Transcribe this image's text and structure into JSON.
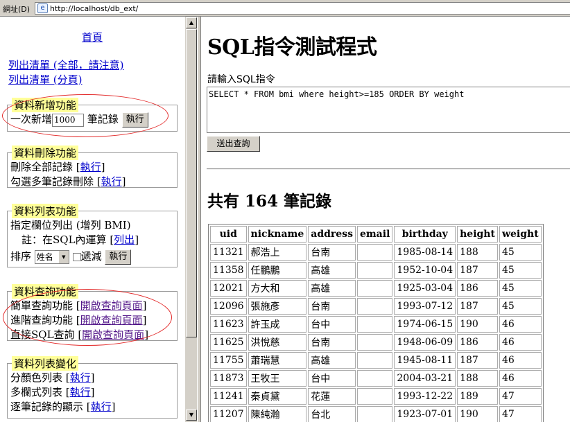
{
  "address_bar": {
    "label": "網址(D)",
    "url": "http://localhost/db_ext/"
  },
  "left": {
    "home_link": "首頁",
    "list_all": "列出清單 (全部，請注意)",
    "list_paged": "列出清單 (分頁)",
    "add": {
      "legend": "資料新增功能",
      "prefix": "一次新增",
      "value": "1000",
      "suffix": "筆記錄",
      "button": "執行"
    },
    "delete": {
      "legend": "資料刪除功能",
      "line1": "刪除全部記錄",
      "line2": "勾選多筆記錄刪除",
      "link": "執行"
    },
    "listfn": {
      "legend": "資料列表功能",
      "line1": "指定欄位列出 (增列 BMI)",
      "note_prefix": "註：在SQL內運算",
      "note_link": "列出",
      "sort_label": "排序",
      "sort_value": "姓名",
      "desc_label": "遞減",
      "button": "執行"
    },
    "query": {
      "legend": "資料查詢功能",
      "line1": "簡單查詢功能",
      "line2": "進階查詢功能",
      "line3": "直接SQL查詢",
      "link": "開啟查詢頁面"
    },
    "vary": {
      "legend": "資料列表變化",
      "line1": "分顏色列表",
      "line2": "多欄式列表",
      "line3": "逐筆記錄的顯示",
      "link": "執行"
    }
  },
  "right": {
    "title": "SQL指令測試程式",
    "prompt": "請輸入SQL指令",
    "sql": "SELECT * FROM bmi where height>=185 ORDER BY weight",
    "submit": "送出查詢",
    "count": "共有 164 筆記錄",
    "columns": [
      "uid",
      "nickname",
      "address",
      "email",
      "birthday",
      "height",
      "weight"
    ],
    "rows": [
      [
        "11321",
        "郝浩上",
        "台南",
        "",
        "1985-08-14",
        "188",
        "45"
      ],
      [
        "11358",
        "任鵬鵬",
        "高雄",
        "",
        "1952-10-04",
        "187",
        "45"
      ],
      [
        "12021",
        "方大和",
        "高雄",
        "",
        "1925-03-04",
        "186",
        "45"
      ],
      [
        "12096",
        "張施彥",
        "台南",
        "",
        "1993-07-12",
        "187",
        "45"
      ],
      [
        "11623",
        "許玉成",
        "台中",
        "",
        "1974-06-15",
        "190",
        "46"
      ],
      [
        "11625",
        "洪悅慈",
        "台南",
        "",
        "1948-06-09",
        "186",
        "46"
      ],
      [
        "11755",
        "蕭瑞慧",
        "高雄",
        "",
        "1945-08-11",
        "187",
        "46"
      ],
      [
        "11873",
        "王牧王",
        "台中",
        "",
        "2004-03-21",
        "188",
        "46"
      ],
      [
        "11241",
        "秦貞黛",
        "花蓮",
        "",
        "1993-12-22",
        "189",
        "47"
      ],
      [
        "11207",
        "陳純瀚",
        "台北",
        "",
        "1923-07-01",
        "190",
        "47"
      ]
    ]
  },
  "colors": {
    "highlight_oval": "#e32b2b",
    "legend_bg": "#ffff99",
    "link": "#0000cc",
    "visited_link": "#551a8b"
  }
}
